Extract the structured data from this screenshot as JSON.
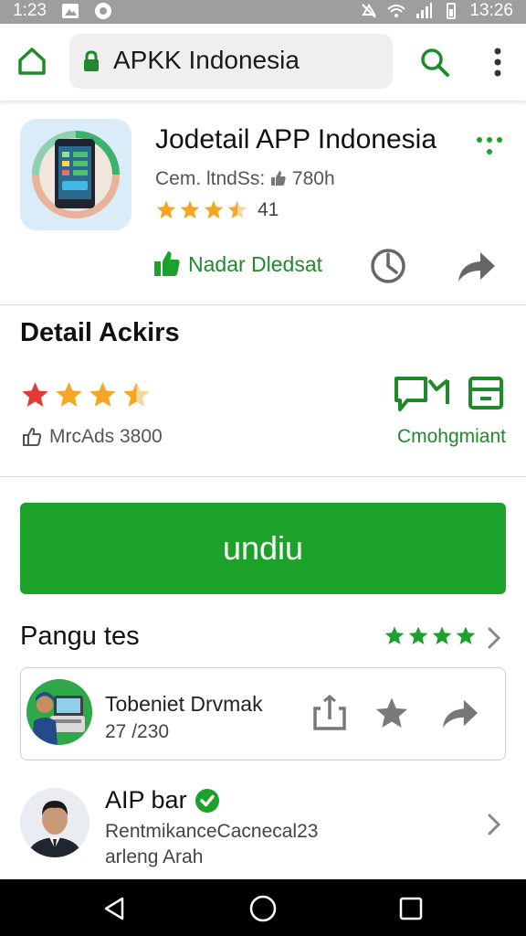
{
  "status_bar": {
    "time": "1:23",
    "right_time": "13:26"
  },
  "toolbar": {
    "url": "APKK Indonesia"
  },
  "app": {
    "title": "Jodetail APP Indonesia",
    "subtitle_prefix": "Cem. ltndSs:",
    "subtitle_count": "780h",
    "rating_value": "41",
    "rating_stars": 3.5,
    "like_label": "Nadar Dledsat"
  },
  "detail": {
    "title": "Detail Ackirs",
    "stars": 3.5,
    "sub_label": "MrcAds 3800",
    "link_label": "Cmohgmiant"
  },
  "download": {
    "label": "undiu"
  },
  "reviews": {
    "title": "Pangu tes",
    "stars": 4,
    "card": {
      "name": "Tobeniet Drvmak",
      "date": "27 /230"
    }
  },
  "developer": {
    "name": "AIP bar",
    "line1": "RentmikanceCacnecal23",
    "line2": "arleng Arah"
  },
  "colors": {
    "accent": "#1ca12a",
    "star_red": "#e53935",
    "star_orange": "#f5a623",
    "star_green": "#1ca12a"
  }
}
